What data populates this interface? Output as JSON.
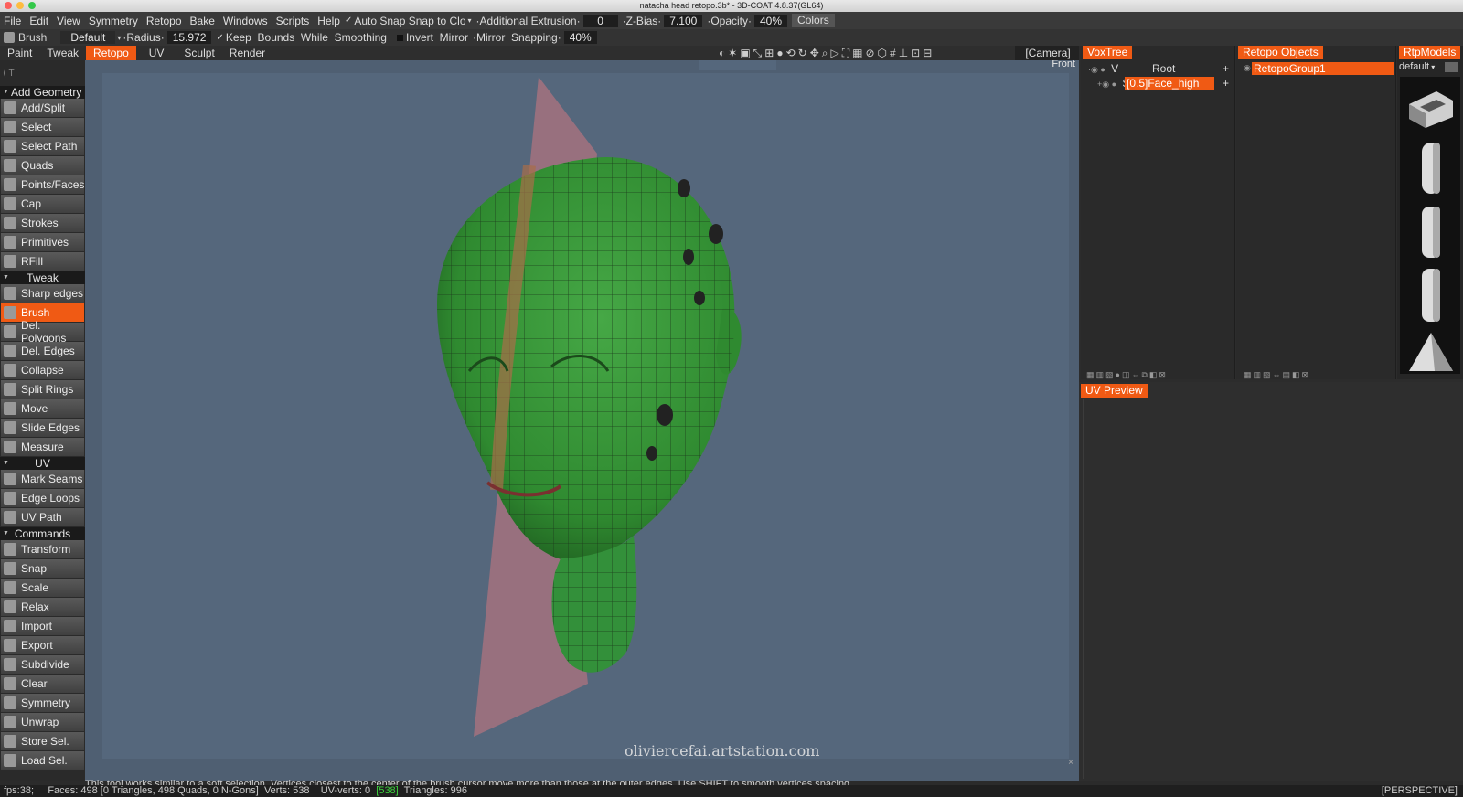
{
  "window": {
    "title": "natacha head retopo.3b* - 3D-COAT 4.8.37(GL64)"
  },
  "menu": [
    "File",
    "Edit",
    "View",
    "Symmetry",
    "Retopo",
    "Bake",
    "Windows",
    "Scripts",
    "Help"
  ],
  "toolbar_top": {
    "auto_snap_label": "Auto",
    "snap_label": "Snap",
    "snap_to_label": "Snap",
    "to_label": "to",
    "clo_label": "Clo",
    "additional_extrusion_label": "Additional",
    "extrusion_label": "Extrusion",
    "extrusion_value": "0",
    "z_bias_label": "Z-Bias",
    "z_bias_value": "7.100",
    "opacity_label": "Opacity",
    "opacity_value": "40%",
    "colors_label": "Colors"
  },
  "brushbar": {
    "brush_label": "Brush",
    "preset_value": "Default",
    "radius_label": "Radius",
    "radius_value": "15.972",
    "keep_label": "Keep",
    "bounds_label": "Bounds",
    "while_label": "While",
    "smoothing_label": "Smoothing",
    "invert_label": "Invert",
    "mirror_label": "Mirror",
    "mirror2_label": "Mirror",
    "snapping_label": "Snapping",
    "snapping_value": "40%"
  },
  "room_tabs": [
    {
      "label": "Paint",
      "active": false
    },
    {
      "label": "Tweak",
      "active": false
    },
    {
      "label": "Retopo",
      "active": true
    },
    {
      "label": "UV",
      "active": false
    },
    {
      "label": "Sculpt",
      "active": false
    },
    {
      "label": "Render",
      "active": false
    }
  ],
  "camera_label": "[Camera]",
  "left_panel": {
    "sections": [
      {
        "title": "Add Geometry",
        "tools": [
          "Add/Split",
          "Select",
          "Select Path",
          "Quads",
          "Points/Faces",
          "Cap",
          "Strokes",
          "Primitives",
          "RFill"
        ]
      },
      {
        "title": "Tweak",
        "tools": [
          "Sharp edges",
          "Brush",
          "Del. Polygons",
          "Del. Edges",
          "Collapse",
          "Split Rings",
          "Move",
          "Slide Edges",
          "Measure"
        ]
      },
      {
        "title": "UV",
        "tools": [
          "Mark Seams",
          "Edge Loops",
          "UV Path"
        ]
      },
      {
        "title": "Commands",
        "tools": [
          "Transform",
          "Snap",
          "Scale",
          "Relax",
          "Import",
          "Export",
          "Subdivide",
          "Clear",
          "Symmetry",
          "Unwrap",
          "Store Sel.",
          "Load Sel."
        ]
      }
    ],
    "active_tool": "Brush"
  },
  "viewport": {
    "view_label": "Front",
    "watermark": "oliviercefai.artstation.com",
    "hint": "This tool works similar to a soft selection. Vertices closest to the center of the brush cursor move more than those at the outer edges. Use SHIFT to smooth vertices spacing"
  },
  "voxtree": {
    "tab": "VoxTree",
    "root_label": "Root",
    "root_flag": "V",
    "child_label": "[0.5]Face_high",
    "child_flag": "S"
  },
  "retopo_objects": {
    "tab": "Retopo  Objects",
    "item": "RetopoGroup1"
  },
  "rtp_models": {
    "tab": "RtpModels",
    "preset": "default"
  },
  "uv_preview": {
    "tab": "UV  Preview"
  },
  "status": {
    "fps": "fps:38;",
    "faces": "Faces: 498 [0 Triangles, 498 Quads, 0 N-Gons]",
    "verts": "Verts: 538",
    "uv_verts": "UV-verts: 0",
    "uv_verts_hl": "[538]",
    "triangles": "Triangles: 996",
    "projection": "[PERSPECTIVE]"
  },
  "colors": {
    "accent": "#f05a14",
    "mesh_green": "#3a9a3a",
    "viewport_bg": "#55677c"
  }
}
